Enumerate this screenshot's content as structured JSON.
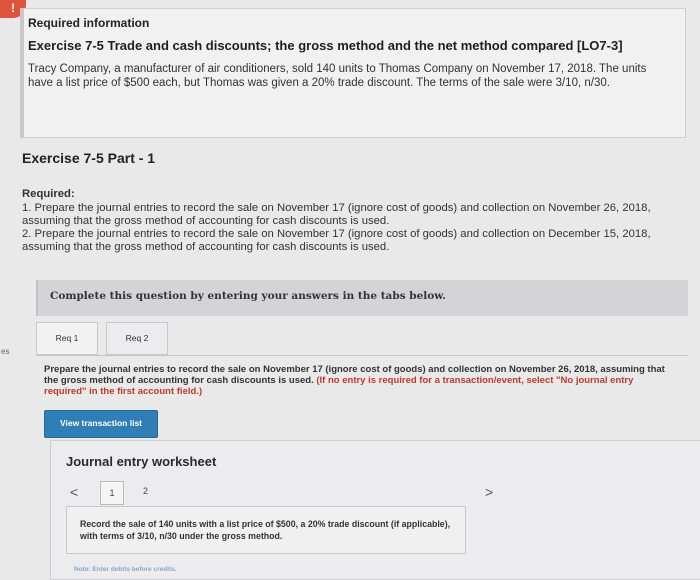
{
  "alert": {
    "label": "!"
  },
  "margin_note": "es",
  "info": {
    "title": "Required information",
    "heading": "Exercise 7-5 Trade and cash discounts; the gross method and the net method compared [LO7-3]",
    "body": "Tracy Company, a manufacturer of air conditioners, sold 140 units to Thomas Company on November 17, 2018. The units have a list price of $500 each, but Thomas was given a 20% trade discount. The terms of the sale were 3/10, n/30."
  },
  "part": {
    "title": "Exercise 7-5 Part - 1"
  },
  "required": {
    "label": "Required:",
    "item1": "1. Prepare the journal entries to record the sale on November 17 (ignore cost of goods) and collection on November 26, 2018, assuming that the gross method of accounting for cash discounts is used.",
    "item2": "2. Prepare the journal entries to record the sale on November 17 (ignore cost of goods) and collection on December 15, 2018, assuming that the gross method of accounting for cash discounts is used."
  },
  "instruction": "Complete this question by entering your answers in the tabs below.",
  "tabs": [
    {
      "label": "Req 1"
    },
    {
      "label": "Req 2"
    }
  ],
  "req1": {
    "text": "Prepare the journal entries to record the sale on November 17 (ignore cost of goods) and collection on November 26, 2018, assuming that the gross method of accounting for cash discounts is used.",
    "hint": "(If no entry is required for a transaction/event, select \"No journal entry required\" in the first account field.)"
  },
  "view_button": "View transaction list",
  "journal": {
    "title": "Journal entry worksheet",
    "prev": "<",
    "next": ">",
    "pages": [
      "1",
      "2"
    ],
    "record_text": "Record the sale of 140 units with a list price of $500, a 20% trade discount (if applicable), with terms of 3/10, n/30 under the gross method.",
    "note": "Note: Enter debits before credits."
  },
  "colors": {
    "accent": "#2f7fb6",
    "alert": "#e0533b",
    "hint": "#c0392b"
  }
}
